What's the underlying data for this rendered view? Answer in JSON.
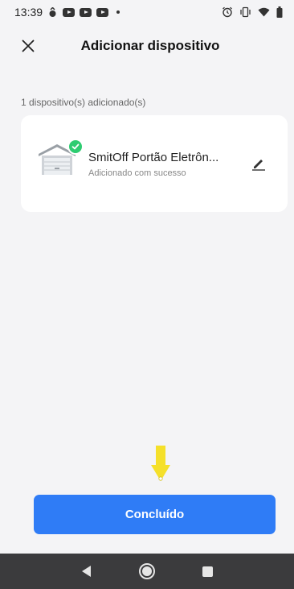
{
  "status_bar": {
    "time": "13:39",
    "icons": [
      "notification-icon",
      "youtube-icon",
      "youtube-icon",
      "youtube-icon",
      "dot-icon",
      "alarm-icon",
      "vibrate-icon",
      "wifi-icon",
      "battery-icon"
    ]
  },
  "header": {
    "title": "Adicionar dispositivo",
    "close_icon": "close-icon"
  },
  "devices_section": {
    "count_label": "1 dispositivo(s) adicionado(s)",
    "items": [
      {
        "name": "SmitOff Portão Eletrôn...",
        "status": "Adicionado com sucesso",
        "icon": "garage-gate-icon",
        "badge_icon": "check-icon",
        "edit_icon": "edit-pencil-icon"
      }
    ]
  },
  "indicator": {
    "icon": "arrow-down-icon",
    "color": "#f5e02a"
  },
  "footer": {
    "done_label": "Concluído"
  },
  "colors": {
    "accent": "#2f7cf6",
    "success": "#2ecc71",
    "background": "#f4f4f6",
    "nav_bar": "#3b3b3d"
  },
  "nav": {
    "icons": [
      "back-icon",
      "home-icon",
      "recents-icon"
    ]
  }
}
